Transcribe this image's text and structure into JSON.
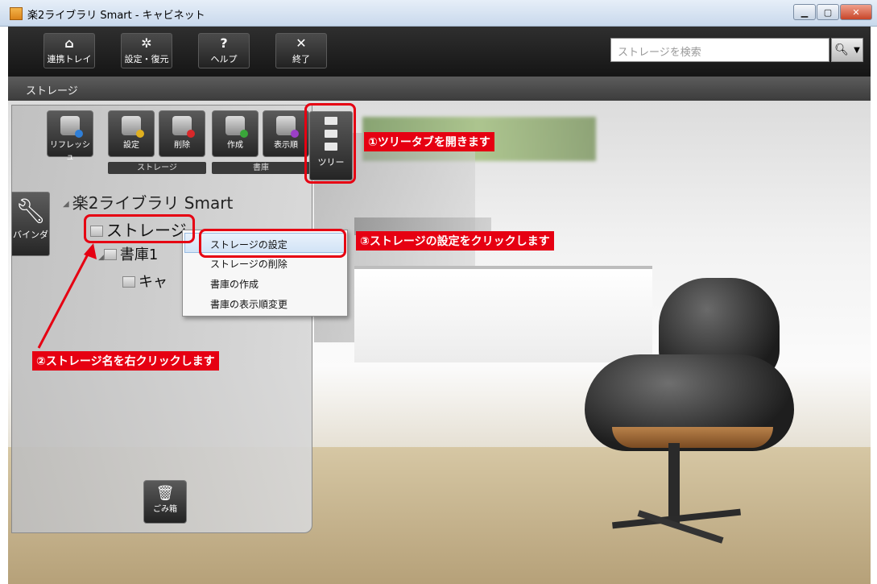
{
  "window": {
    "title": "楽2ライブラリ Smart - キャビネット"
  },
  "toolbar": {
    "buttons": [
      {
        "label": "連携トレイ"
      },
      {
        "label": "設定・復元"
      },
      {
        "label": "ヘルプ"
      },
      {
        "label": "終了"
      }
    ],
    "search_placeholder": "ストレージを検索"
  },
  "breadcrumb": "ストレージ",
  "panel": {
    "buttons": [
      {
        "label": "リフレッシュ"
      },
      {
        "label": "設定"
      },
      {
        "label": "削除"
      },
      {
        "label": "作成"
      },
      {
        "label": "表示順"
      }
    ],
    "groups": [
      "ストレージ",
      "書庫"
    ],
    "tree_tab": "ツリー",
    "binder_tab": "バインダ",
    "trash": "ごみ箱"
  },
  "tree": {
    "root": "楽2ライブラリ Smart",
    "storage": "ストレージ",
    "shoko": "書庫1",
    "cabinet": "キャ"
  },
  "context_menu": {
    "items": [
      "ストレージの設定",
      "ストレージの削除",
      "書庫の作成",
      "書庫の表示順変更"
    ]
  },
  "annotations": {
    "step1": "①ツリータブを開きます",
    "step2": "②ストレージ名を右クリックします",
    "step3": "③ストレージの設定をクリックします"
  },
  "colors": {
    "annotation": "#e60012",
    "toolbar": "#1a1a1a"
  }
}
